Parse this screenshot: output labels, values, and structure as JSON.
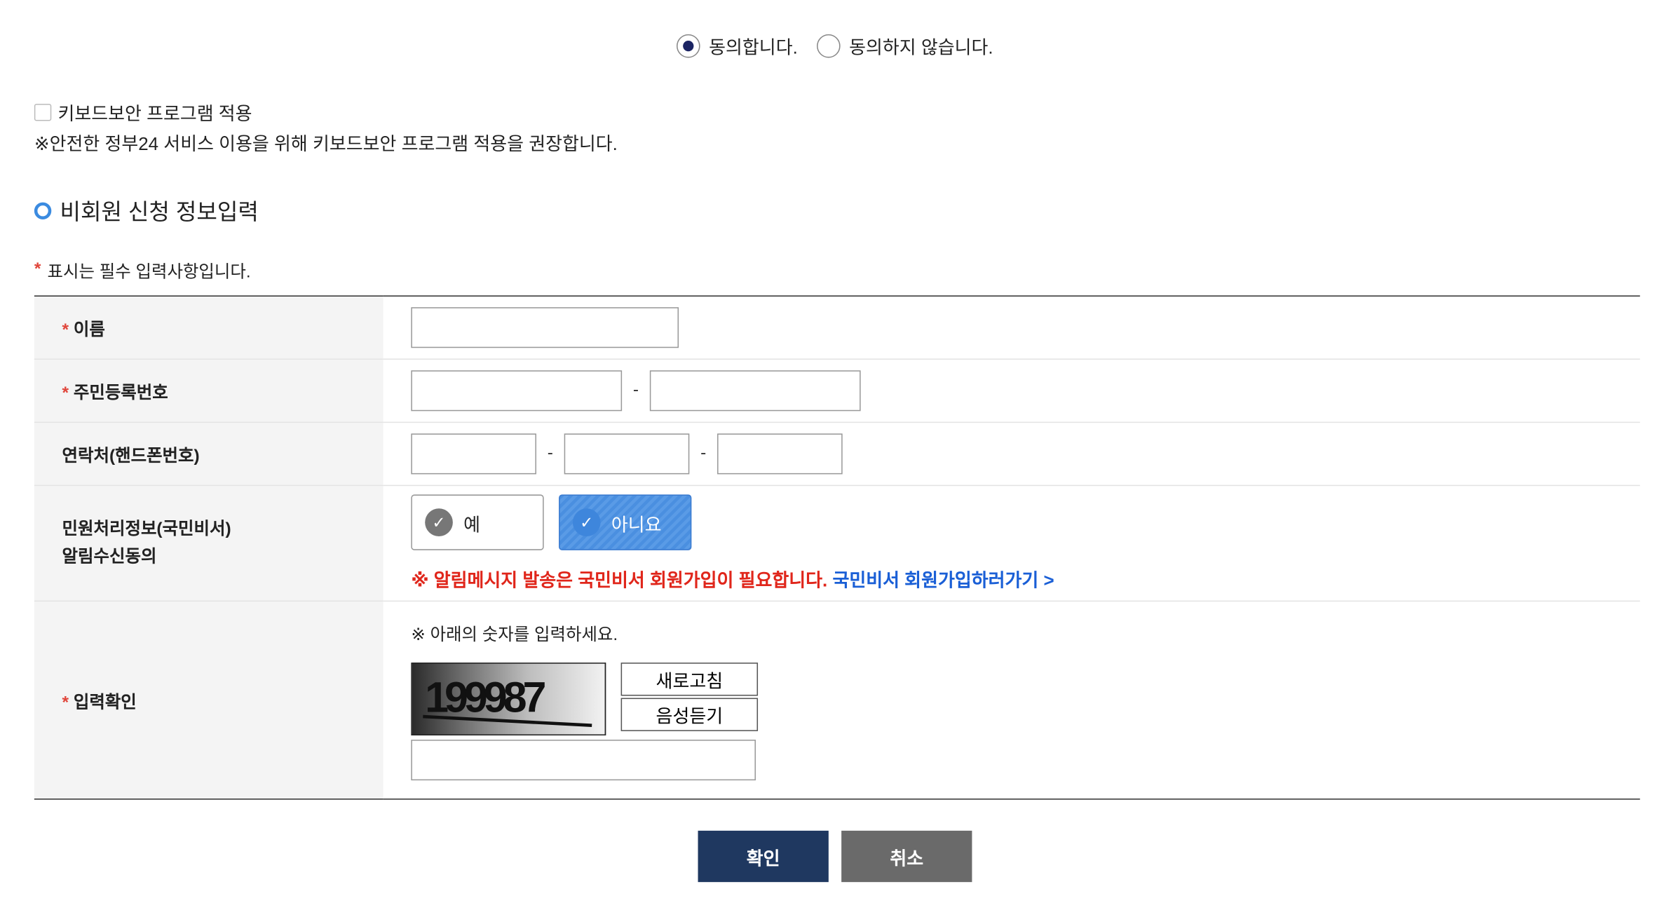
{
  "agreement": {
    "agree_label": "동의합니다.",
    "disagree_label": "동의하지 않습니다.",
    "selected": "agree"
  },
  "keyboard_security": {
    "label": "키보드보안 프로그램 적용",
    "note": "※안전한 정부24 서비스 이용을 위해 키보드보안 프로그램 적용을 권장합니다."
  },
  "section_title": "비회원 신청 정보입력",
  "required_note": "표시는 필수 입력사항입니다.",
  "required_mark": "*",
  "form": {
    "name_label": "이름",
    "resident_label": "주민등록번호",
    "phone_label": "연락처(핸드폰번호)",
    "alert_label_line1": "민원처리정보(국민비서)",
    "alert_label_line2": "알림수신동의",
    "yes_label": "예",
    "no_label": "아니요",
    "alert_warning": "※ 알림메시지 발송은 국민비서 회원가입이 필요합니다.",
    "alert_link": "국민비서 회원가입하러가기 >",
    "captcha_label": "입력확인",
    "captcha_note": "※  아래의 숫자를 입력하세요.",
    "captcha_text": "199987",
    "refresh_label": "새로고침",
    "audio_label": "음성듣기",
    "dash": "-"
  },
  "buttons": {
    "confirm": "확인",
    "cancel": "취소"
  },
  "colors": {
    "confirm_bg": "#1f3860",
    "cancel_bg": "#6a6a6a",
    "required_star": "#e0453a",
    "link_blue": "#1a5fd6",
    "warning_red": "#e0261b"
  }
}
